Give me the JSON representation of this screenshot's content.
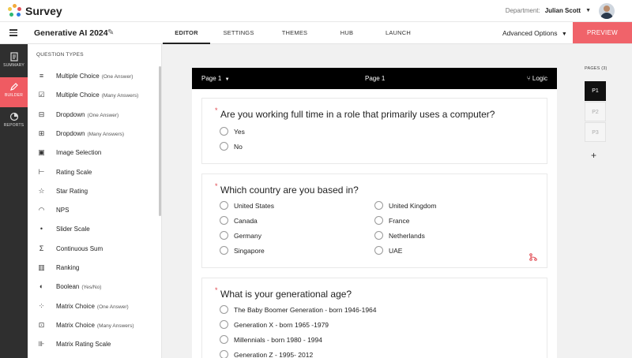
{
  "app": {
    "name": "Survey"
  },
  "header": {
    "department_label": "Department:",
    "user_name": "Julian Scott"
  },
  "toolbar": {
    "survey_title": "Generative AI 2024",
    "tabs": [
      {
        "label": "EDITOR",
        "active": true
      },
      {
        "label": "SETTINGS",
        "active": false
      },
      {
        "label": "THEMES",
        "active": false
      },
      {
        "label": "HUB",
        "active": false
      },
      {
        "label": "LAUNCH",
        "active": false
      }
    ],
    "advanced_options": "Advanced Options",
    "preview": "PREVIEW"
  },
  "rail": [
    {
      "label": "SUMMARY",
      "icon": "document-icon",
      "active": false
    },
    {
      "label": "BUILDER",
      "icon": "pencil-icon",
      "active": true
    },
    {
      "label": "REPORTS",
      "icon": "pie-chart-icon",
      "active": false
    }
  ],
  "question_types": {
    "heading": "QUESTION TYPES",
    "items": [
      {
        "label": "Multiple Choice",
        "sub": "(One Answer)",
        "icon": "radio-list-icon"
      },
      {
        "label": "Multiple Choice",
        "sub": "(Many Answers)",
        "icon": "checkbox-icon"
      },
      {
        "label": "Dropdown",
        "sub": "(One Answer)",
        "icon": "dropdown-icon"
      },
      {
        "label": "Dropdown",
        "sub": "(Many Answers)",
        "icon": "dropdown-multi-icon"
      },
      {
        "label": "Image Selection",
        "sub": "",
        "icon": "image-icon"
      },
      {
        "label": "Rating Scale",
        "sub": "",
        "icon": "rating-scale-icon"
      },
      {
        "label": "Star Rating",
        "sub": "",
        "icon": "star-icon"
      },
      {
        "label": "NPS",
        "sub": "",
        "icon": "gauge-icon"
      },
      {
        "label": "Slider Scale",
        "sub": "",
        "icon": "slider-icon"
      },
      {
        "label": "Continuous Sum",
        "sub": "",
        "icon": "sum-icon"
      },
      {
        "label": "Ranking",
        "sub": "",
        "icon": "ranking-icon"
      },
      {
        "label": "Boolean",
        "sub": "(Yes/No)",
        "icon": "toggle-icon"
      },
      {
        "label": "Matrix Choice",
        "sub": "(One Answer)",
        "icon": "matrix-radio-icon"
      },
      {
        "label": "Matrix Choice",
        "sub": "(Many Answers)",
        "icon": "matrix-check-icon"
      },
      {
        "label": "Matrix Rating Scale",
        "sub": "",
        "icon": "matrix-scale-icon"
      }
    ]
  },
  "editor": {
    "page_selector": "Page 1",
    "page_title": "Page 1",
    "logic_label": "Logic",
    "required_mark": "*",
    "questions": [
      {
        "text": "Are you working full time in a role that primarily uses a computer?",
        "options": [
          "Yes",
          "No"
        ]
      },
      {
        "text": "Which country are you based in?",
        "options": [
          "United States",
          "United Kingdom",
          "Canada",
          "France",
          "Germany",
          "Netherlands",
          "Singapore",
          "UAE"
        ]
      },
      {
        "text": "What is your generational age?",
        "options": [
          "The Baby Boomer Generation - born 1946-1964",
          "Generation X - born 1965 -1979",
          "Millennials - born 1980 - 1994",
          "Generation Z - 1995- 2012"
        ]
      }
    ]
  },
  "pages": {
    "heading": "PAGES (3)",
    "items": [
      "P1",
      "P2",
      "P3"
    ],
    "add": "+"
  },
  "colors": {
    "accent": "#f0636a",
    "rail": "#2f2f2f",
    "required": "#e0474f"
  }
}
